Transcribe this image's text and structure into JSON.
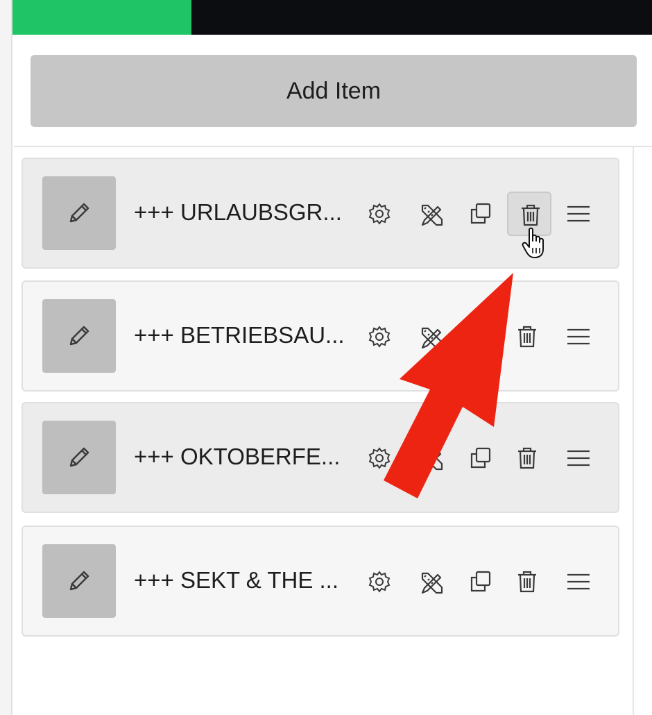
{
  "header": {
    "progress_percent": 28,
    "progress_color": "#1ec466",
    "bar_color": "#0b0d10"
  },
  "toolbar": {
    "add_item_label": "Add Item"
  },
  "items": [
    {
      "title": "+++ URLAUBSGR...",
      "thumb_icon": "pencil-icon"
    },
    {
      "title": "+++ BETRIEBSAU...",
      "thumb_icon": "pencil-icon"
    },
    {
      "title": "+++ OKTOBERFE...",
      "thumb_icon": "pencil-icon"
    },
    {
      "title": "+++ SEKT & THE ...",
      "thumb_icon": "pencil-icon"
    }
  ],
  "item_actions": [
    "gear-icon",
    "design-tools-icon",
    "duplicate-icon",
    "trash-icon",
    "drag-handle-icon"
  ],
  "annotation": {
    "arrow_color": "#ee2412",
    "points_to": "trash-icon"
  }
}
